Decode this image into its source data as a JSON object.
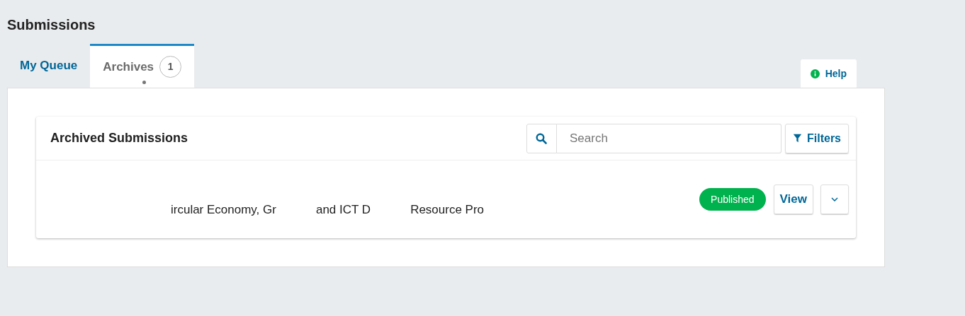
{
  "page_title": "Submissions",
  "tabs": [
    {
      "label": "My Queue",
      "selected": false
    },
    {
      "label": "Archives",
      "selected": true,
      "count": "1"
    }
  ],
  "help": {
    "label": "Help"
  },
  "card": {
    "title": "Archived Submissions",
    "search": {
      "placeholder": "Search"
    },
    "filters_button": "Filters"
  },
  "submissions": [
    {
      "title_fragments": [
        "ircular Economy, Gr",
        "and ICT D",
        "Resource Pro"
      ],
      "status": "Published",
      "view_button": "View"
    }
  ]
}
